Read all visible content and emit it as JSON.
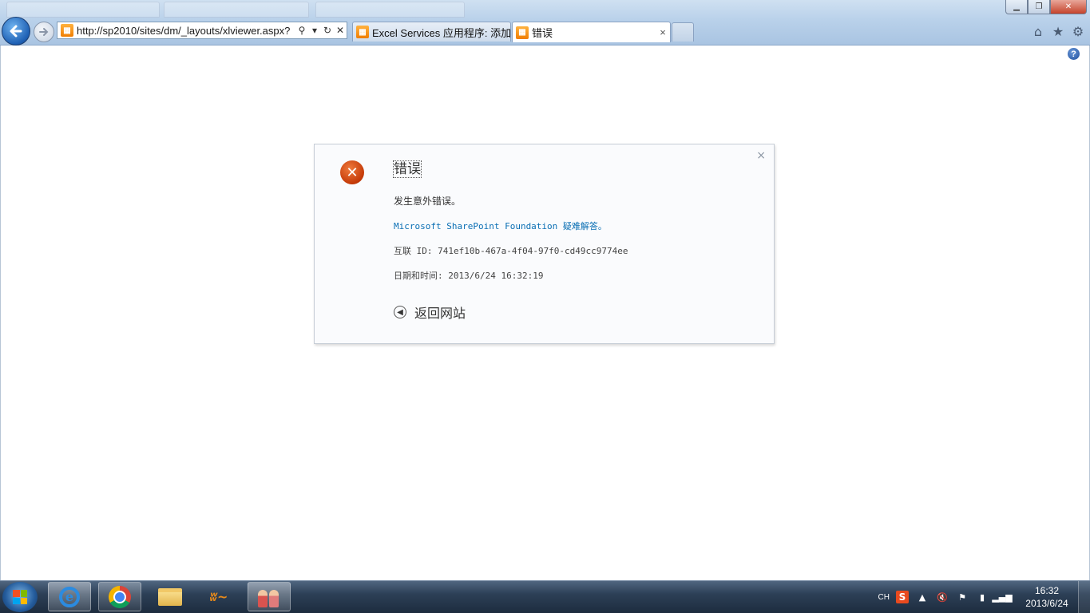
{
  "browser": {
    "address_url": "http://sp2010/sites/dm/_layouts/xlviewer.aspx?",
    "tabs": [
      {
        "label": "Excel Services 应用程序: 添加..."
      },
      {
        "label": "错误"
      }
    ],
    "tab_close_glyph": "×"
  },
  "dialog": {
    "title": "错误",
    "message": "发生意外错误。",
    "troubleshoot_link": "Microsoft SharePoint Foundation 疑难解答。",
    "correlation": "互联 ID: 741ef10b-467a-4f04-97f0-cd49cc9774ee",
    "datetime": "日期和时间: 2013/6/24 16:32:19",
    "back_label": "返回网站",
    "close_glyph": "×"
  },
  "help": {
    "glyph": "?"
  },
  "taskbar": {
    "apps": [
      "ie-icon",
      "chrome-icon",
      "explorer-icon",
      "unicom-icon",
      "qq-icon"
    ],
    "lang": "CH",
    "ime_glyph": "S",
    "clock_time": "16:32",
    "clock_date": "2013/6/24"
  }
}
